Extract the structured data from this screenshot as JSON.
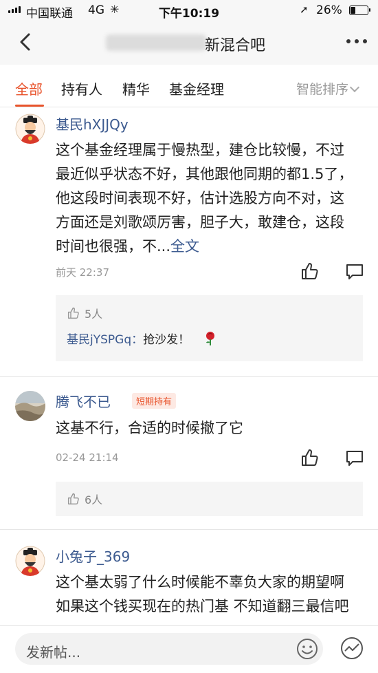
{
  "status": {
    "carrier": "中国联通",
    "network": "4G",
    "time": "下午10:19",
    "battery_pct": "26%",
    "battery_level": 0.26
  },
  "nav": {
    "title_visible": "新混合吧"
  },
  "tabs": [
    {
      "label": "全部",
      "active": true
    },
    {
      "label": "持有人",
      "active": false
    },
    {
      "label": "精华",
      "active": false
    },
    {
      "label": "基金经理",
      "active": false
    }
  ],
  "sort_label": "智能排序",
  "posts": [
    {
      "username": "基民hXJJQy",
      "badge": "",
      "content": "这个基金经理属于慢热型，建仓比较慢，不过最近似乎状态不好，其他跟他同期的都1.5了，他这段时间表现不好，估计选股方向不对，这方面还是刘歌颂厉害，胆子大，敢建仓，这段时间也很强，不...",
      "more_link": "全文",
      "time": "前天 22:37",
      "likes": "5人",
      "reply_user": "基民jYSPGq：",
      "reply_text": "抢沙发！"
    },
    {
      "username": "腾飞不已",
      "badge": "短期持有",
      "content": "这基不行，合适的时候撤了它",
      "time": "02-24 21:14",
      "likes": "6人"
    },
    {
      "username": "小兔子_369",
      "badge": "",
      "content": "这个基太弱了什么时候能不辜负大家的期望啊 如果这个钱买现在的热门基 不知道翻三最信吧"
    }
  ],
  "compose_placeholder": "发新帖...",
  "colors": {
    "accent": "#e8532b",
    "username": "#3c5a8f",
    "muted": "#999999"
  }
}
